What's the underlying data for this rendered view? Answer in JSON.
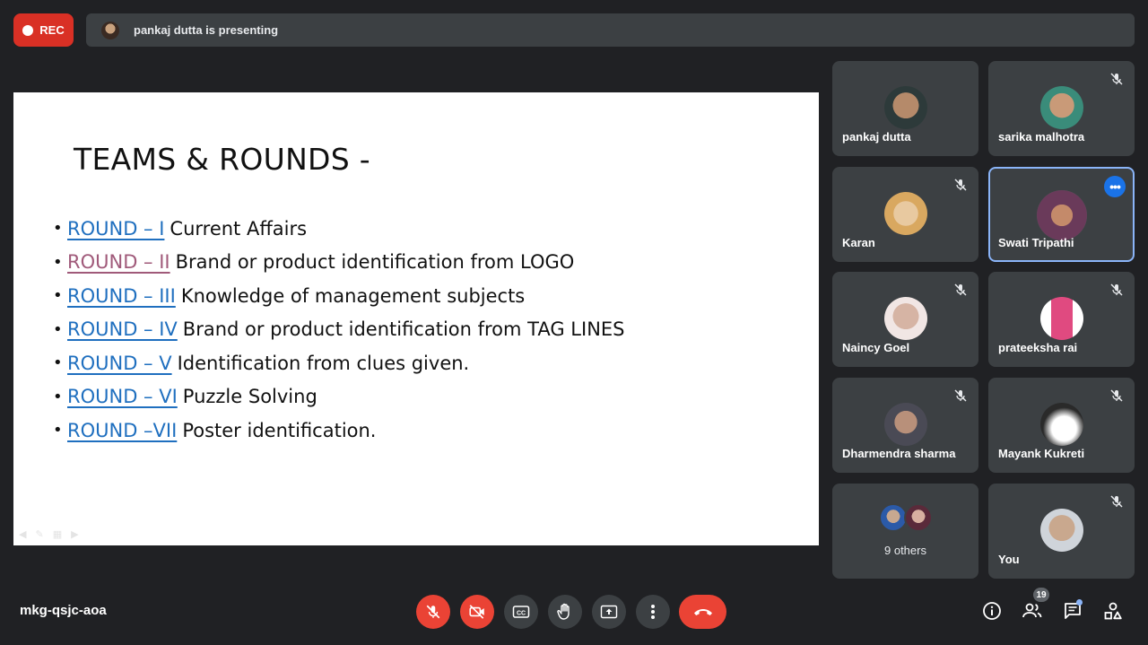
{
  "top": {
    "rec_label": "REC",
    "presenting_text": "pankaj dutta is presenting"
  },
  "slide": {
    "title": "TEAMS & ROUNDS -",
    "rounds": [
      {
        "link": "ROUND – I",
        "text": "Current Affairs"
      },
      {
        "link": "ROUND – II",
        "text": "Brand or product identification from LOGO"
      },
      {
        "link": "ROUND – III",
        "text": "Knowledge of management subjects"
      },
      {
        "link": "ROUND – IV",
        "text": "Brand or product identification from TAG LINES"
      },
      {
        "link": "ROUND – V",
        "text": "Identification from clues given."
      },
      {
        "link": "ROUND – VI",
        "text": "Puzzle Solving"
      },
      {
        "link": "ROUND –VII",
        "text": "Poster identification."
      }
    ]
  },
  "participants": [
    {
      "name": "pankaj dutta",
      "muted": false
    },
    {
      "name": "sarika malhotra",
      "muted": true
    },
    {
      "name": "Karan",
      "muted": true
    },
    {
      "name": "Swati Tripathi",
      "muted": false,
      "active": true
    },
    {
      "name": "Naincy Goel",
      "muted": true
    },
    {
      "name": "prateeksha rai",
      "muted": true
    },
    {
      "name": "Dharmendra sharma",
      "muted": true
    },
    {
      "name": "Mayank Kukreti",
      "muted": true
    },
    {
      "name": "9 others",
      "muted": false
    },
    {
      "name": "You",
      "muted": true
    }
  ],
  "bottom": {
    "meeting_code": "mkg-qsjc-aoa",
    "people_count": "19",
    "icons": [
      "mic-off-icon",
      "camera-off-icon",
      "captions-icon",
      "raise-hand-icon",
      "present-icon",
      "more-icon",
      "end-call-icon",
      "info-icon",
      "people-icon",
      "chat-icon",
      "activities-icon"
    ]
  },
  "colors": {
    "background": "#202124",
    "tile": "#3c4043",
    "danger": "#ea4335",
    "accent": "#1a73e8",
    "active_border": "#8ab4f8",
    "slide_link": "#1f6fbf"
  }
}
